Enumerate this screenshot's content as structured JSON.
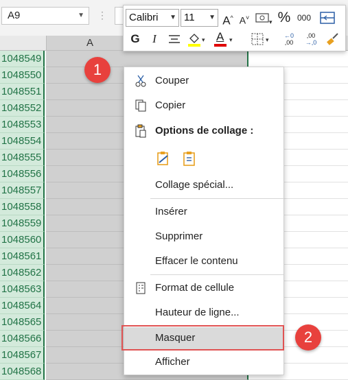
{
  "name_box": {
    "value": "A9"
  },
  "formula_bar": {
    "dots": "⋮"
  },
  "columns": {
    "a": "A"
  },
  "rows": [
    "1048549",
    "1048550",
    "1048551",
    "1048552",
    "1048553",
    "1048554",
    "1048555",
    "1048556",
    "1048557",
    "1048558",
    "1048559",
    "1048560",
    "1048561",
    "1048562",
    "1048563",
    "1048564",
    "1048565",
    "1048566",
    "1048567",
    "1048568"
  ],
  "mini_toolbar": {
    "font": "Calibri",
    "size": "11",
    "grow_font": "A^",
    "shrink_font": "A˅",
    "percent": "%",
    "thousands": "000",
    "bold": "G",
    "italic": "I",
    "font_color_letter": "A",
    "decrease_decimals_top": "←0",
    "decrease_decimals_bottom": ",00",
    "increase_decimals_top": ",00",
    "increase_decimals_bottom": "→,0"
  },
  "context_menu": {
    "cut": "Couper",
    "copy": "Copier",
    "paste_options": "Options de collage :",
    "paste_special": "Collage spécial...",
    "insert": "Insérer",
    "delete": "Supprimer",
    "clear": "Effacer le contenu",
    "format_cells": "Format de cellule",
    "row_height": "Hauteur de ligne...",
    "hide": "Masquer",
    "unhide": "Afficher"
  },
  "badges": {
    "one": "1",
    "two": "2"
  },
  "colors": {
    "accent_green": "#217346",
    "badge_red": "#e8413d",
    "highlight_box": "#e05252",
    "fill_yellow": "#ffff00",
    "font_red": "#e00000"
  }
}
